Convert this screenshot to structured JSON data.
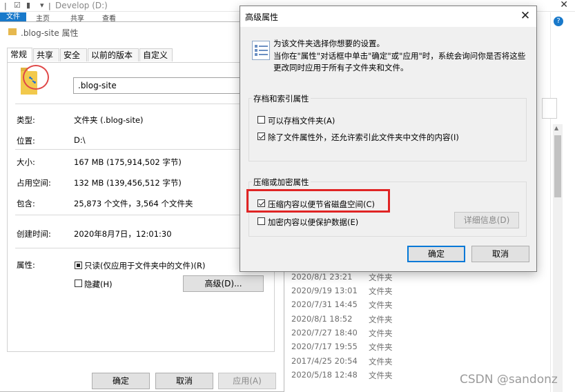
{
  "explorer": {
    "title": "Develop (D:)",
    "ribbon_tabs": [
      "文件",
      "主页",
      "共享",
      "查看"
    ],
    "help_label": "?",
    "files": [
      {
        "date": "2020/8/1 23:21",
        "type": "文件夹"
      },
      {
        "date": "2020/9/19 13:01",
        "type": "文件夹"
      },
      {
        "date": "2020/7/31 14:45",
        "type": "文件夹"
      },
      {
        "date": "2020/8/1 18:52",
        "type": "文件夹"
      },
      {
        "date": "2020/7/27 18:40",
        "type": "文件夹"
      },
      {
        "date": "2020/7/17 19:55",
        "type": "文件夹"
      },
      {
        "date": "2017/4/25 20:54",
        "type": "文件夹"
      },
      {
        "date": "2020/5/18 12:48",
        "type": "文件夹"
      }
    ]
  },
  "properties": {
    "title": ".blog-site 属性",
    "tabs": [
      "常规",
      "共享",
      "安全",
      "以前的版本",
      "自定义"
    ],
    "name_value": ".blog-site",
    "rows": {
      "type": {
        "label": "类型:",
        "value": "文件夹 (.blog-site)"
      },
      "location": {
        "label": "位置:",
        "value": "D:\\"
      },
      "size": {
        "label": "大小:",
        "value": "167 MB (175,914,502 字节)"
      },
      "on_disk": {
        "label": "占用空间:",
        "value": "132 MB (139,456,512 字节)"
      },
      "contains": {
        "label": "包含:",
        "value": "25,873 个文件，3,564 个文件夹"
      },
      "created": {
        "label": "创建时间:",
        "value": "2020年8月7日，12:01:30"
      }
    },
    "attributes_label": "属性:",
    "readonly_label": "只读(仅应用于文件夹中的文件)(R)",
    "hidden_label": "隐藏(H)",
    "advanced_button": "高级(D)...",
    "ok": "确定",
    "cancel": "取消",
    "apply": "应用(A)"
  },
  "advanced": {
    "title": "高级属性",
    "close": "✕",
    "desc1": "为该文件夹选择你想要的设置。",
    "desc2": "当你在\"属性\"对话框中单击\"确定\"或\"应用\"时，系统会询问你是否将这些更改同时应用于所有子文件夹和文件。",
    "archive_group": "存档和索引属性",
    "archive_label": "可以存档文件夹(A)",
    "index_label": "除了文件属性外，还允许索引此文件夹中文件的内容(I)",
    "compress_group": "压缩或加密属性",
    "compress_label": "压缩内容以便节省磁盘空间(C)",
    "encrypt_label": "加密内容以便保护数据(E)",
    "details_button": "详细信息(D)",
    "ok": "确定",
    "cancel": "取消",
    "checks": {
      "archive": false,
      "index": true,
      "compress": true,
      "encrypt": false
    }
  },
  "watermark": "CSDN @sandonz",
  "colors": {
    "highlight": "#e02424",
    "accent": "#0078d7"
  }
}
